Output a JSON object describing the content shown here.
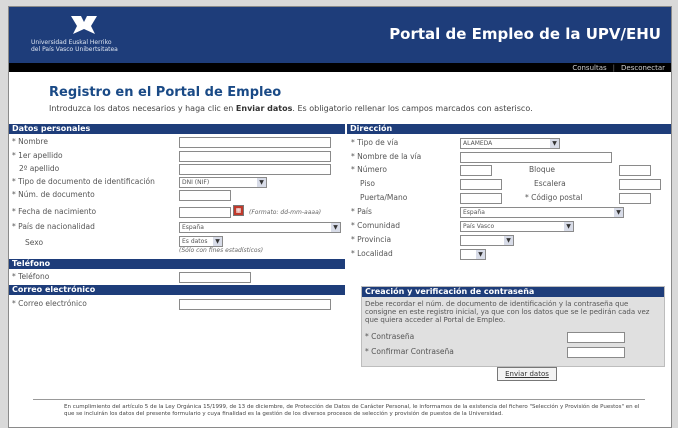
{
  "header": {
    "logo_text_line1": "Universidad    Euskal Herriko",
    "logo_text_line2": "del País Vasco    Unibertsitatea",
    "portal_title": "Portal de Empleo de la UPV/EHU"
  },
  "top_links": {
    "consultas": "Consultas",
    "desconectar": "Desconectar"
  },
  "registro": {
    "title": "Registro en el Portal de Empleo",
    "intro_pre": "Introduzca los datos necesarios y haga clic en ",
    "intro_bold": "Enviar datos",
    "intro_post": ". Es obligatorio rellenar los campos marcados con asterisco."
  },
  "datos_personales": {
    "heading": "Datos personales",
    "nombre": "* Nombre",
    "apellido1": "* 1er apellido",
    "apellido2": "2º apellido",
    "tipo_doc": "* Tipo de documento de identificación",
    "tipo_doc_value": "DNI (NIF)",
    "num_doc": "* Núm. de documento",
    "fecha_nac": "* Fecha de nacimiento",
    "fecha_hint": "(Formato: dd-mm-aaaa)",
    "pais_nac": "* País de nacionalidad",
    "pais_nac_value": "España",
    "sexo": "Sexo",
    "sexo_value": "Es datos",
    "sexo_hint": "(Sólo con fines estadísticos)"
  },
  "telefono": {
    "heading": "Teléfono",
    "label": "* Teléfono"
  },
  "correo": {
    "heading": "Correo electrónico",
    "label": "* Correo electrónico"
  },
  "direccion": {
    "heading": "Dirección",
    "tipo_via": "* Tipo de vía",
    "tipo_via_value": "ALAMEDA",
    "nombre_via": "* Nombre de la vía",
    "numero": "* Número",
    "bloque": "Bloque",
    "piso": "Piso",
    "escalera": "Escalera",
    "puerta": "Puerta/Mano",
    "codigo_postal": "* Código postal",
    "pais": "* País",
    "pais_value": "España",
    "comunidad": "* Comunidad",
    "comunidad_value": "País Vasco",
    "provincia": "* Provincia",
    "localidad": "* Localidad"
  },
  "password": {
    "heading": "Creación y verificación de contraseña",
    "desc": "Debe recordar el núm. de documento de identificación y la contraseña que consigne en este registro inicial, ya que con los datos que se le pedirán cada vez que quiera acceder al Portal de Empleo.",
    "contrasena": "* Contraseña",
    "confirmar": "* Confirmar Contraseña"
  },
  "send_button": "Enviar datos",
  "footer_text": "En cumplimiento del artículo 5 de la Ley Orgánica 15/1999, de 13 de diciembre, de Protección de Datos de Carácter Personal, le informamos de la existencia del fichero \"Selección y Provisión de Puestos\" en el que se incluirán los datos del presente formulario y cuya finalidad es la gestión de los diversos procesos de selección y provisión de puestos de la Universidad.",
  "colors": {
    "brand": "#1e3d7a",
    "title": "#1a4a86"
  }
}
